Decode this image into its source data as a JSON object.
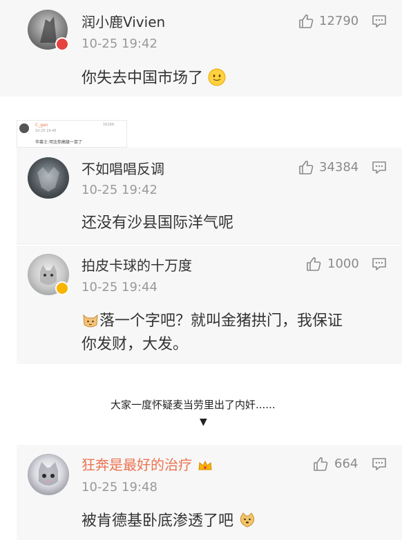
{
  "comments": [
    {
      "name": "润小鹿Vivien",
      "time": "10-25 19:42",
      "likes": "12790",
      "text": "你失去中国市场了"
    },
    {
      "name": "不如唱唱反调",
      "time": "10-25 19:42",
      "likes": "34384",
      "text": "还没有沙县国际洋气呢"
    },
    {
      "name": "拍皮卡球的十万度",
      "time": "10-25 19:44",
      "likes": "1000",
      "text_line1": "落一个字吧？就叫金猪拱门，我保证",
      "text_line2": "你发财，大发。"
    },
    {
      "name": "狂奔是最好的治疗",
      "time": "10-25 19:48",
      "likes": "664",
      "text": "被肯德基卧底渗透了吧"
    }
  ],
  "mini_comment": {
    "name": "C_gan",
    "time": "10-25 19:45",
    "likes": "16199",
    "text": "华莱士:可比你高级一百了"
  },
  "caption": "大家一度怀疑麦当劳里出了内奸......",
  "arrow": "▼",
  "colors": {
    "name_orange": "#eb7350",
    "accent_orange": "#f7b500"
  },
  "icons": [
    "thumb-up-icon",
    "comment-icon",
    "smile-emoji-icon",
    "cat-emoji-icon",
    "doge-emoji-icon",
    "crown-icon"
  ]
}
